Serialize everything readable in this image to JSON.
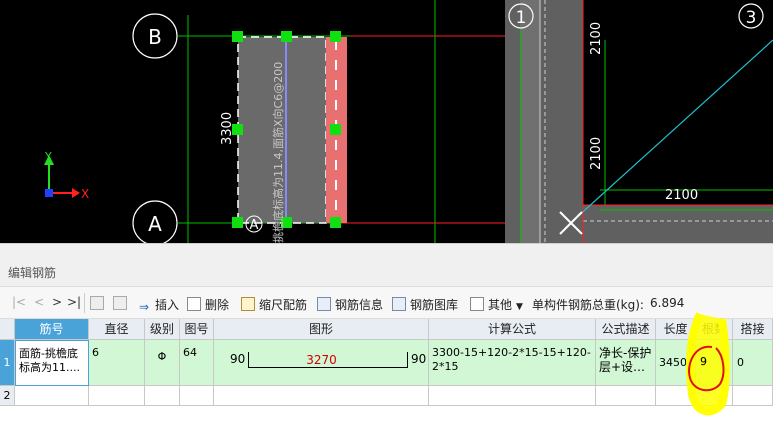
{
  "cad": {
    "axis_labels": [
      "B",
      "A",
      "1",
      "3"
    ],
    "dim_vertical_3300": "3300",
    "dim_2100_a": "2100",
    "dim_2100_b": "2100",
    "dim_2100_c": "2100",
    "rebar_text": "挑檐底标高为11.4,面筋X向C6@200",
    "ucs_x": "X",
    "ucs_y": "Y"
  },
  "panel": {
    "title": "编辑钢筋",
    "toolbar": {
      "first": "|<",
      "prev": "<",
      "next": ">",
      "last": ">|",
      "insert": "插入",
      "delete": "删除",
      "scale_rebar": "缩尺配筋",
      "rebar_info": "钢筋信息",
      "rebar_lib": "钢筋图库",
      "other": "其他",
      "weight_label": "单构件钢筋总重(kg):",
      "weight_value": "6.894"
    },
    "columns": [
      "筋号",
      "直径(mm)",
      "级别",
      "图号",
      "图形",
      "计算公式",
      "公式描述",
      "长度",
      "根数",
      "搭接"
    ],
    "rows": [
      {
        "num": "1",
        "name": "面筋-挑檐底标高为11....",
        "diameter": "6",
        "grade": "Φ",
        "fig": "64",
        "shape_left": "90",
        "shape_mid": "3270",
        "shape_right": "90",
        "formula": "3300-15+120-2*15-15+120-2*15",
        "desc": "净长-保护层+设…",
        "length": "3450",
        "count": "9",
        "lap": "0"
      },
      {
        "num": "2",
        "name": "",
        "diameter": "",
        "grade": "",
        "fig": "",
        "shape_left": "",
        "shape_mid": "",
        "shape_right": "",
        "formula": "",
        "desc": "",
        "length": "",
        "count": "",
        "lap": ""
      }
    ]
  },
  "colors": {
    "cad_bg": "#000000",
    "grid_line": "#00c000",
    "red_line": "#ff2020",
    "slab_gray": "#707070",
    "beam_pink": "#e87070",
    "cyan": "#20c0d0",
    "row_selected": "#d2f7d4",
    "header_active": "#4aa3d8",
    "highlight_yellow": "#ffff00"
  }
}
